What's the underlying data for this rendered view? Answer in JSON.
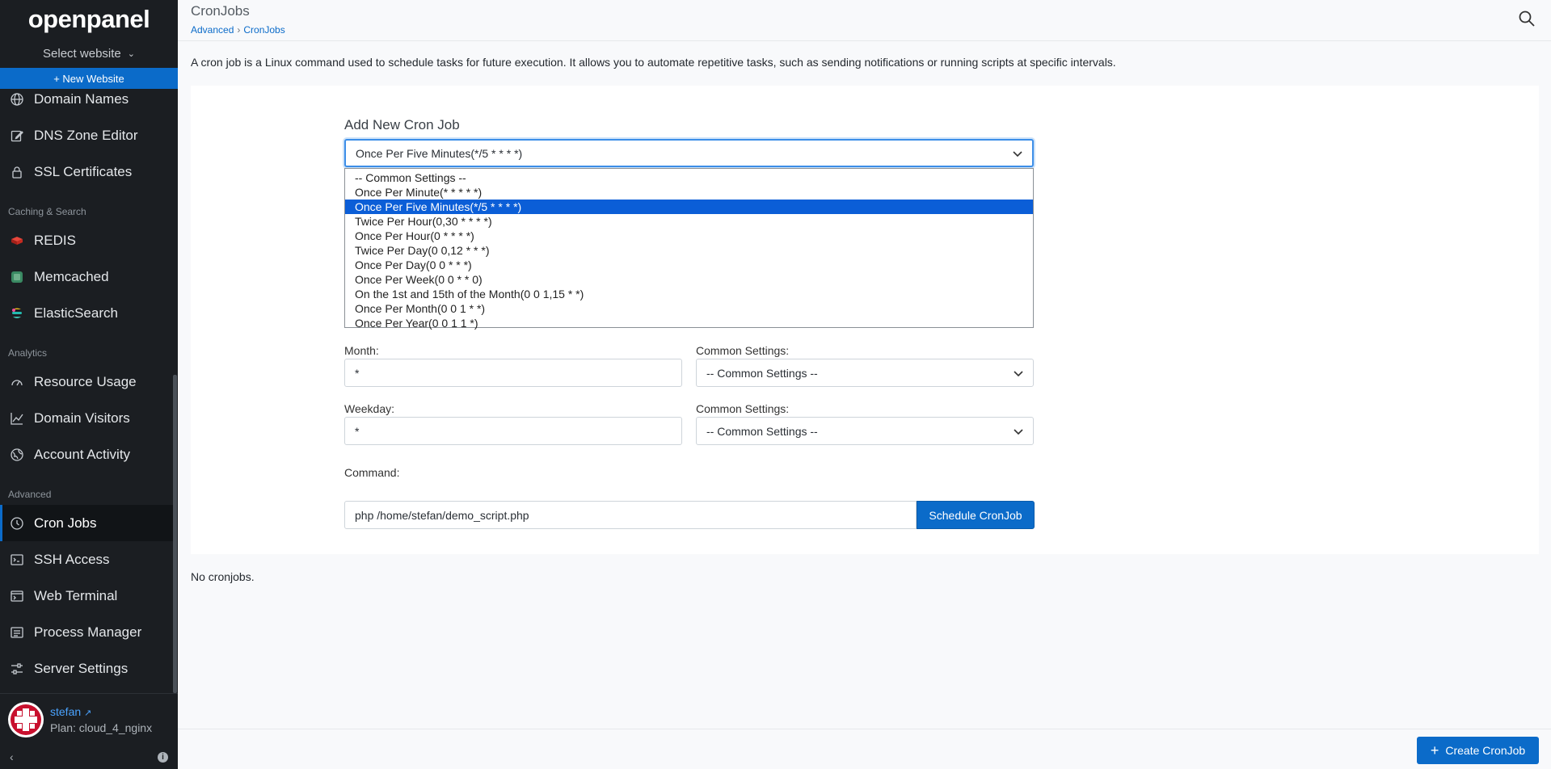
{
  "sidebar": {
    "logo": "openpanel",
    "select_website": "Select website",
    "new_website": "+ New Website",
    "items_top": [
      {
        "label": "Domain Names",
        "icon": "globe-icon"
      },
      {
        "label": "DNS Zone Editor",
        "icon": "edit-icon"
      },
      {
        "label": "SSL Certificates",
        "icon": "lock-icon"
      }
    ],
    "section_caching": "Caching & Search",
    "items_caching": [
      {
        "label": "REDIS",
        "icon": "redis-icon",
        "color": "#d82c20"
      },
      {
        "label": "Memcached",
        "icon": "memcached-icon",
        "color": "#3a8a63"
      },
      {
        "label": "ElasticSearch",
        "icon": "elasticsearch-icon",
        "color": "#f3bd19"
      }
    ],
    "section_analytics": "Analytics",
    "items_analytics": [
      {
        "label": "Resource Usage",
        "icon": "gauge-icon"
      },
      {
        "label": "Domain Visitors",
        "icon": "chart-icon"
      },
      {
        "label": "Account Activity",
        "icon": "globe-activity-icon"
      }
    ],
    "section_advanced": "Advanced",
    "items_advanced": [
      {
        "label": "Cron Jobs",
        "icon": "clock-icon",
        "active": true
      },
      {
        "label": "SSH Access",
        "icon": "terminal-box-icon"
      },
      {
        "label": "Web Terminal",
        "icon": "terminal-window-icon"
      },
      {
        "label": "Process Manager",
        "icon": "process-icon"
      },
      {
        "label": "Server Settings",
        "icon": "sliders-icon"
      }
    ],
    "user": {
      "name": "stefan",
      "plan": "Plan: cloud_4_nginx"
    }
  },
  "header": {
    "title": "CronJobs",
    "breadcrumb": [
      "Advanced",
      "CronJobs"
    ]
  },
  "intro": "A cron job is a Linux command used to schedule tasks for future execution. It allows you to automate repetitive tasks, such as sending notifications or running scripts at specific intervals.",
  "form": {
    "title": "Add New Cron Job",
    "selected": "Once Per Five Minutes(*/5 * * * *)",
    "options": [
      "-- Common Settings --",
      "Once Per Minute(* * * * *)",
      "Once Per Five Minutes(*/5 * * * *)",
      "Twice Per Hour(0,30 * * * *)",
      "Once Per Hour(0 * * * *)",
      "Twice Per Day(0 0,12 * * *)",
      "Once Per Day(0 0 * * *)",
      "Once Per Week(0 0 * * 0)",
      "On the 1st and 15th of the Month(0 0 1,15 * *)",
      "Once Per Month(0 0 1 * *)",
      "Once Per Year(0 0 1 1 *)"
    ],
    "month_label": "Month:",
    "month_value": "*",
    "weekday_label": "Weekday:",
    "weekday_value": "*",
    "common_label": "Common Settings:",
    "common_value": "-- Common Settings --",
    "command_label": "Command:",
    "command_value": "php /home/stefan/demo_script.php",
    "schedule_button": "Schedule CronJob"
  },
  "empty_text": "No cronjobs.",
  "footer": {
    "create_button": "Create CronJob"
  },
  "colors": {
    "accent": "#0b6bc9",
    "sidebar_bg": "#1b1e22"
  }
}
